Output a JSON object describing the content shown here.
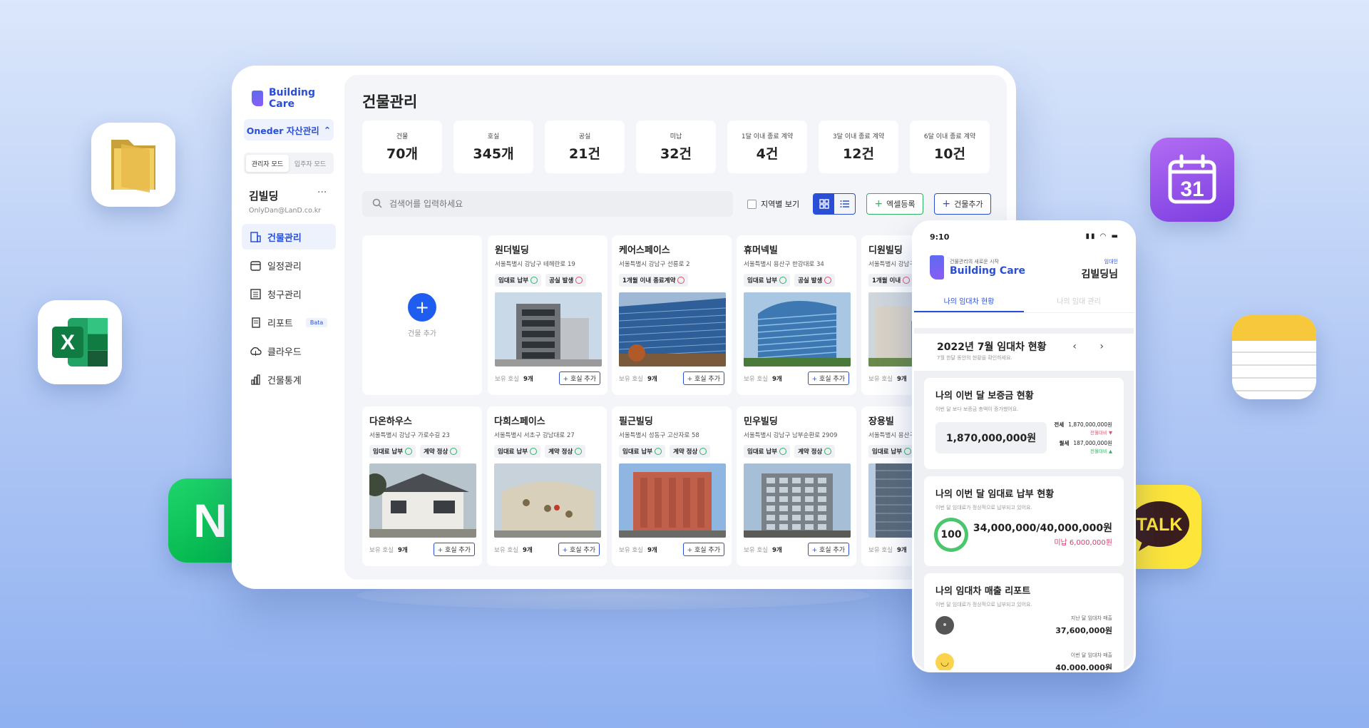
{
  "app": {
    "brand": "Building Care"
  },
  "sidebar": {
    "asset_selector": "Oneder 자산관리",
    "modes": [
      "관리자 모드",
      "입주자 모드"
    ],
    "user": {
      "name": "김빌딩",
      "more": "···",
      "email": "OnlyDan@LanD.co.kr"
    },
    "nav": [
      {
        "label": "건물관리",
        "icon": "building-icon",
        "active": true
      },
      {
        "label": "일정관리",
        "icon": "calendar-icon"
      },
      {
        "label": "청구관리",
        "icon": "invoice-icon"
      },
      {
        "label": "리포트",
        "icon": "report-icon",
        "badge": "Bata"
      },
      {
        "label": "클라우드",
        "icon": "cloud-upload-icon"
      },
      {
        "label": "건물통계",
        "icon": "bar-chart-icon"
      }
    ]
  },
  "main": {
    "title": "건물관리",
    "stats": [
      {
        "label": "건물",
        "value": "70개"
      },
      {
        "label": "호실",
        "value": "345개"
      },
      {
        "label": "공실",
        "value": "21건"
      },
      {
        "label": "미납",
        "value": "32건"
      },
      {
        "label": "1달 이내 종료 계약",
        "value": "4건"
      },
      {
        "label": "3달 이내 종료 계약",
        "value": "12건"
      },
      {
        "label": "6달 이내 종료 계약",
        "value": "10건"
      }
    ],
    "search_placeholder": "검색어를 입력하세요",
    "region_label": "지역별 보기",
    "excel_button": "엑셀등록",
    "add_building_button": "건물추가",
    "add_card_label": "건물 추가",
    "units_label": "보유 호실",
    "add_unit_label": "호실 추가",
    "buildings": [
      {
        "name": "원더빌딩",
        "addr": "서울특별시 강남구 테헤란로 19",
        "tags": [
          [
            "임대료 납부",
            "good"
          ],
          [
            "공실 발생",
            "bad"
          ]
        ],
        "units": "9개",
        "photo": "modern"
      },
      {
        "name": "케어스페이스",
        "addr": "서울특별시 강남구 선릉로 2",
        "tags": [
          [
            "1개월 이내 종료계약",
            "bad"
          ]
        ],
        "units": "9개",
        "photo": "glass"
      },
      {
        "name": "휴머넥빌",
        "addr": "서울특별시 용산구 한강대로 34",
        "tags": [
          [
            "임대료 납부",
            "good"
          ],
          [
            "공실 발생",
            "bad"
          ]
        ],
        "units": "9개",
        "photo": "tower"
      },
      {
        "name": "디원빌딩",
        "addr": "서울특별시 강남구",
        "tags": [
          [
            "1개월 이내",
            "bad"
          ]
        ],
        "units": "9개",
        "photo": "street"
      },
      {
        "name": "다온하우스",
        "addr": "서울특별시 강남구 가로수길 23",
        "tags": [
          [
            "임대료 납부",
            "good"
          ],
          [
            "계약 정상",
            "good"
          ]
        ],
        "units": "9개",
        "photo": "house"
      },
      {
        "name": "다희스페이스",
        "addr": "서울특별시 서초구 강남대로 27",
        "tags": [
          [
            "임대료 납부",
            "good"
          ],
          [
            "계약 정상",
            "good"
          ]
        ],
        "units": "9개",
        "photo": "curve"
      },
      {
        "name": "필근빌딩",
        "addr": "서울특별시 성동구 고산자로 58",
        "tags": [
          [
            "임대료 납부",
            "good"
          ],
          [
            "계약 정상",
            "good"
          ]
        ],
        "units": "9개",
        "photo": "brick"
      },
      {
        "name": "민우빌딩",
        "addr": "서울특별시 강남구 남부순환로 2909",
        "tags": [
          [
            "임대료 납부",
            "good"
          ],
          [
            "계약 정상",
            "good"
          ]
        ],
        "units": "9개",
        "photo": "office"
      },
      {
        "name": "장용빌",
        "addr": "서울특별시 용산구",
        "tags": [
          [
            "임대료 납부",
            "good"
          ]
        ],
        "units": "9개",
        "photo": "high"
      }
    ]
  },
  "phone": {
    "time": "9:10",
    "status": "▮▮ ◠ ▬",
    "logo_sub": "건물관리의 새로운 시작",
    "logo_main": "Building Care",
    "role": "임대인",
    "user": "김빌딩님",
    "tabs": [
      "나의 임대차 현황",
      "나의 임대 관리"
    ],
    "period_title": "2022년 7월 임대차 현황",
    "period_sub": "7월 한달 동안의 현황을 확인하세요.",
    "arrows": "‹ ›",
    "deposit": {
      "title": "나의 이번 달 보증금 현황",
      "sub": "이번 달 보다 보증금 총액이 증가했어요.",
      "total": "1,870,000,000원",
      "jeonse_label": "전세",
      "jeonse_value": "1,870,000,000원",
      "jeonse_change": "전월대비 ▼",
      "wolse_label": "월세",
      "wolse_value": "187,000,000원",
      "wolse_change": "전월대비 ▲"
    },
    "rent": {
      "title": "나의 이번 달 임대료 납부 현황",
      "sub": "이번 달 임대료가 정상적으로 납부되고 있어요.",
      "score": "100",
      "score_percent": 100,
      "amount": "34,000,000/40,000,000원",
      "unpaid": "미납 6,000,000원"
    },
    "report": {
      "title": "나의 임대차 매출 리포트",
      "sub": "이번 달 임대료가 정상적으로 납부되고 있어요.",
      "last_label": "지난 달 임대차 매출",
      "last_value": "37,600,000원",
      "this_label": "이번 달 임대차 매출",
      "this_value": "40,000,000원"
    }
  },
  "icons": {
    "talk_text": "TALK",
    "calendar_day": "31",
    "naver_letter": "N",
    "excel_letter": "X"
  },
  "colors": {
    "accent": "#2a4fd6",
    "good": "#2bb463",
    "bad": "#e0506b"
  }
}
